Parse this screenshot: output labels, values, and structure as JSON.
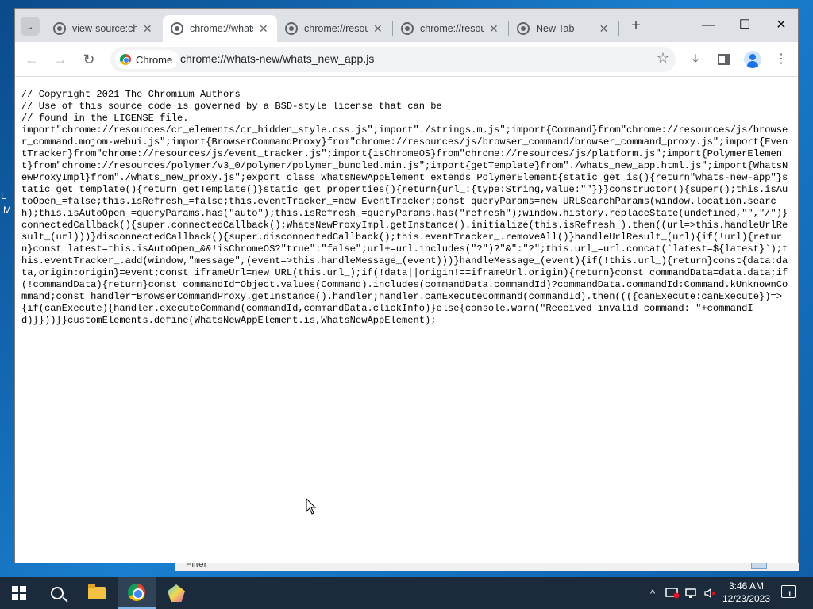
{
  "desktop": {
    "fragments": [
      "L",
      "M"
    ]
  },
  "background_window": {
    "label": "Filter"
  },
  "browser": {
    "tabs": [
      {
        "title": "view-source:chrome://resources",
        "active": false
      },
      {
        "title": "chrome://whats-new/whats_new_app.js",
        "active": true
      },
      {
        "title": "chrome://resources/js/browser_command",
        "active": false
      },
      {
        "title": "chrome://resources/js/event_tracker.js",
        "active": false
      },
      {
        "title": "New Tab",
        "active": false
      }
    ],
    "tab_dropdown_icon": "chevron-down-icon",
    "new_tab_label": "+",
    "window_controls": {
      "minimize": "—",
      "maximize": "☐",
      "close": "✕"
    },
    "toolbar": {
      "back_icon": "←",
      "forward_icon": "→",
      "reload_icon": "↻",
      "site_chip_label": "Chrome",
      "url": "chrome://whats-new/whats_new_app.js",
      "bookmark_icon": "☆",
      "download_icon": "⤓",
      "menu_icon": "⋮"
    },
    "page_source": "// Copyright 2021 The Chromium Authors\n// Use of this source code is governed by a BSD-style license that can be\n// found in the LICENSE file.\nimport\"chrome://resources/cr_elements/cr_hidden_style.css.js\";import\"./strings.m.js\";import{Command}from\"chrome://resources/js/browser_command.mojom-webui.js\";import{BrowserCommandProxy}from\"chrome://resources/js/browser_command/browser_command_proxy.js\";import{EventTracker}from\"chrome://resources/js/event_tracker.js\";import{isChromeOS}from\"chrome://resources/js/platform.js\";import{PolymerElement}from\"chrome://resources/polymer/v3_0/polymer/polymer_bundled.min.js\";import{getTemplate}from\"./whats_new_app.html.js\";import{WhatsNewProxyImpl}from\"./whats_new_proxy.js\";export class WhatsNewAppElement extends PolymerElement{static get is(){return\"whats-new-app\"}static get template(){return getTemplate()}static get properties(){return{url_:{type:String,value:\"\"}}}constructor(){super();this.isAutoOpen_=false;this.isRefresh_=false;this.eventTracker_=new EventTracker;const queryParams=new URLSearchParams(window.location.search);this.isAutoOpen_=queryParams.has(\"auto\");this.isRefresh_=queryParams.has(\"refresh\");window.history.replaceState(undefined,\"\",\"/\")}connectedCallback(){super.connectedCallback();WhatsNewProxyImpl.getInstance().initialize(this.isRefresh_).then((url=>this.handleUrlResult_(url)))}disconnectedCallback(){super.disconnectedCallback();this.eventTracker_.removeAll()}handleUrlResult_(url){if(!url){return}const latest=this.isAutoOpen_&&!isChromeOS?\"true\":\"false\";url+=url.includes(\"?\")?\"&\":\"?\";this.url_=url.concat(`latest=${latest}`);this.eventTracker_.add(window,\"message\",(event=>this.handleMessage_(event)))}handleMessage_(event){if(!this.url_){return}const{data:data,origin:origin}=event;const iframeUrl=new URL(this.url_);if(!data||origin!==iframeUrl.origin){return}const commandData=data.data;if(!commandData){return}const commandId=Object.values(Command).includes(commandData.commandId)?commandData.commandId:Command.kUnknownCommand;const handler=BrowserCommandProxy.getInstance().handler;handler.canExecuteCommand(commandId).then((({canExecute:canExecute})=>{if(canExecute){handler.executeCommand(commandId,commandData.clickInfo)}else{console.warn(\"Received invalid command: \"+commandId)}}))}}customElements.define(WhatsNewAppElement.is,WhatsNewAppElement);"
  },
  "taskbar": {
    "items": [
      "start",
      "search",
      "file-explorer",
      "chrome",
      "gem-app"
    ],
    "tray_chevron": "^",
    "clock_time": "3:46 AM",
    "clock_date": "12/23/2023",
    "notification_count": "1"
  }
}
